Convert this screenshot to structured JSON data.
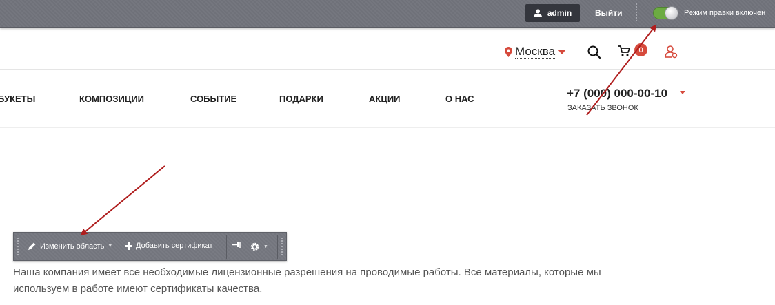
{
  "admin_bar": {
    "user_label": "admin",
    "logout_label": "Выйти",
    "edit_mode_label": "Режим правки включен",
    "toggle_on": true,
    "toggle_color": "#6cab42"
  },
  "header": {
    "city": "Москва",
    "cart_count": "0",
    "accent_color": "#d64a3c",
    "icons": [
      "location-pin-icon",
      "caret-down-icon",
      "search-icon",
      "cart-icon",
      "user-icon"
    ]
  },
  "nav": {
    "items": [
      "БУКЕТЫ",
      "КОМПОЗИЦИИ",
      "СОБЫТИЕ",
      "ПОДАРКИ",
      "АКЦИИ",
      "О НАС"
    ],
    "phone": "+7 (000) 000-00-10",
    "callback": "ЗАКАЗАТЬ ЗВОНОК"
  },
  "area_toolbar": {
    "edit_area": "Изменить область",
    "add_certificate": "Добавить сертификат"
  },
  "content": {
    "text": "Наша компания имеет все необходимые лицензионные разрешения на проводимые работы. Все материалы, которые мы используем в работе имеют сертификаты качества."
  }
}
